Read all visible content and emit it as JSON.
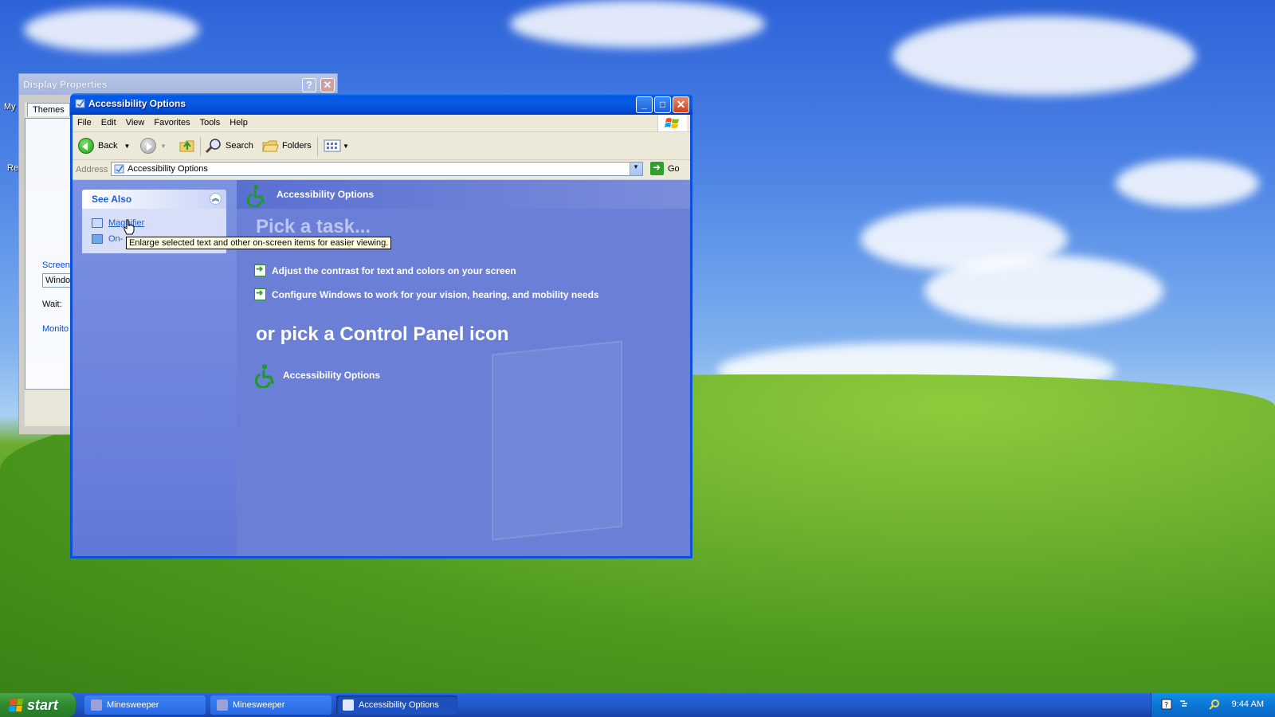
{
  "desktop": {
    "labels": [
      "My",
      "Re"
    ]
  },
  "display_properties": {
    "title": "Display Properties",
    "help_btn": "?",
    "close_btn": "✕",
    "tab_themes": "Themes",
    "screen_label": "Screen",
    "screen_field": "Windo",
    "wait_label": "Wait:",
    "monitor_label": "Monito"
  },
  "window": {
    "title": "Accessibility Options",
    "minimize": "_",
    "maximize": "□",
    "close": "✕"
  },
  "menu": [
    "File",
    "Edit",
    "View",
    "Favorites",
    "Tools",
    "Help"
  ],
  "toolbar": {
    "back": "Back",
    "search": "Search",
    "folders": "Folders"
  },
  "address": {
    "label": "Address",
    "value": "Accessibility Options",
    "go": "Go"
  },
  "see_also": {
    "header": "See Also",
    "items": [
      "Magnifier",
      "On-"
    ]
  },
  "tooltip": "Enlarge selected text and other on-screen items for easier viewing.",
  "main": {
    "header": "Accessibility Options",
    "pick_task": "Pick a task...",
    "tasks": [
      "Adjust the contrast for text and colors on your screen",
      "Configure Windows to work for your vision, hearing, and mobility needs"
    ],
    "pick_icon": "or pick a Control Panel icon",
    "cp_item": "Accessibility Options"
  },
  "taskbar": {
    "start": "start",
    "buttons": [
      "Minesweeper",
      "Minesweeper",
      "Accessibility Options"
    ],
    "time": "9:44 AM"
  },
  "colors": {
    "taskbar": "#245edc",
    "start": "#2f8a2f",
    "window_frame": "#0a50d8",
    "task_pane": "#6b7fd6"
  }
}
